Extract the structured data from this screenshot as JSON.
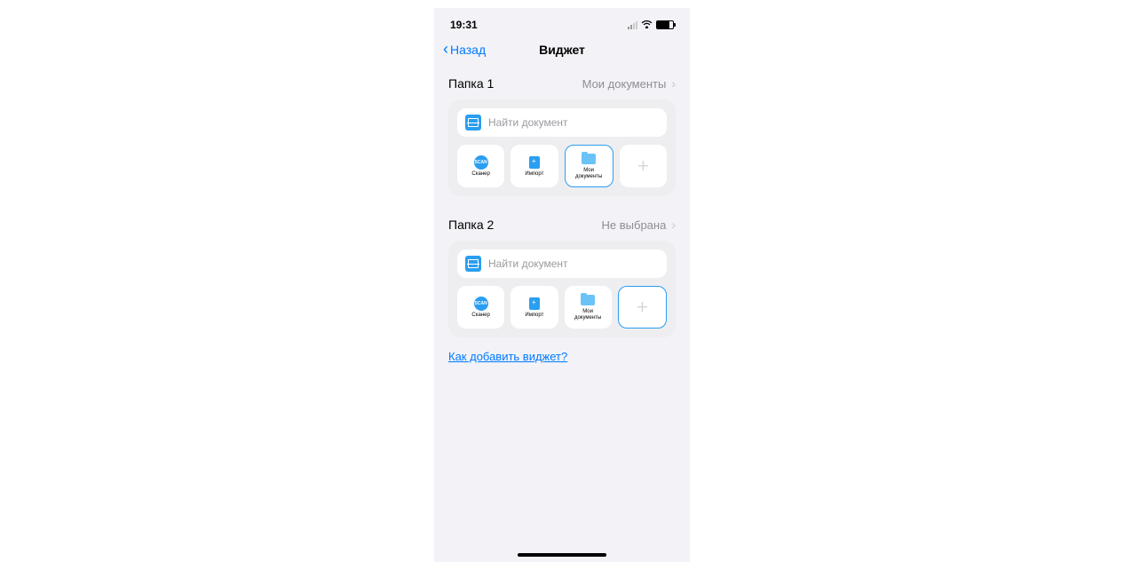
{
  "status": {
    "time": "19:31"
  },
  "nav": {
    "back": "Назад",
    "title": "Виджет"
  },
  "folders": [
    {
      "label": "Папка 1",
      "value": "Мои документы",
      "selected_tile": 2
    },
    {
      "label": "Папка 2",
      "value": "Не выбрана",
      "selected_tile": 3
    }
  ],
  "search_placeholder": "Найти документ",
  "tiles": {
    "scanner": "Сканер",
    "import": "Импорт",
    "documents_line1": "Мои",
    "documents_line2": "документы"
  },
  "help_link": "Как добавить виджет?"
}
